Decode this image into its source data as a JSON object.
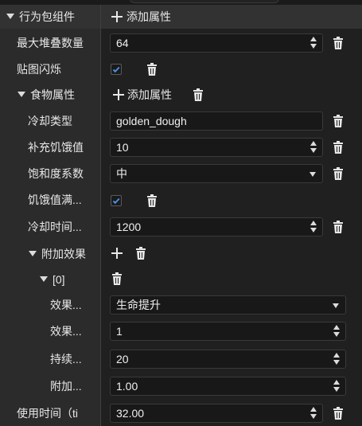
{
  "header": {
    "title": "行为包组件",
    "add_label": "添加属性"
  },
  "rows": {
    "max_stack": {
      "label": "最大堆叠数量",
      "value": "64"
    },
    "texture_flash": {
      "label": "贴图闪烁",
      "checked": true
    },
    "food": {
      "label": "食物属性",
      "add_label": "添加属性"
    },
    "cooldown_type": {
      "label": "冷却类型",
      "value": "golden_dough"
    },
    "nutrition": {
      "label": "补充饥饿值",
      "value": "10"
    },
    "saturation": {
      "label": "饱和度系数",
      "value": "中"
    },
    "can_eat_full": {
      "label": "饥饿值满...",
      "checked": true
    },
    "cooldown_time": {
      "label": "冷却时间...",
      "value": "1200"
    },
    "effects": {
      "label": "附加效果"
    },
    "effect0": {
      "label": "[0]"
    },
    "effect_name": {
      "label": "效果...",
      "value": "生命提升"
    },
    "effect_amp": {
      "label": "效果...",
      "value": "1"
    },
    "effect_duration": {
      "label": "持续...",
      "value": "20"
    },
    "effect_chance": {
      "label": "附加...",
      "value": "1.00"
    },
    "use_duration": {
      "label": "使用时间（ti",
      "value": "32.00"
    }
  },
  "colors": {
    "accent": "#4a90e2",
    "background": "#202020"
  }
}
